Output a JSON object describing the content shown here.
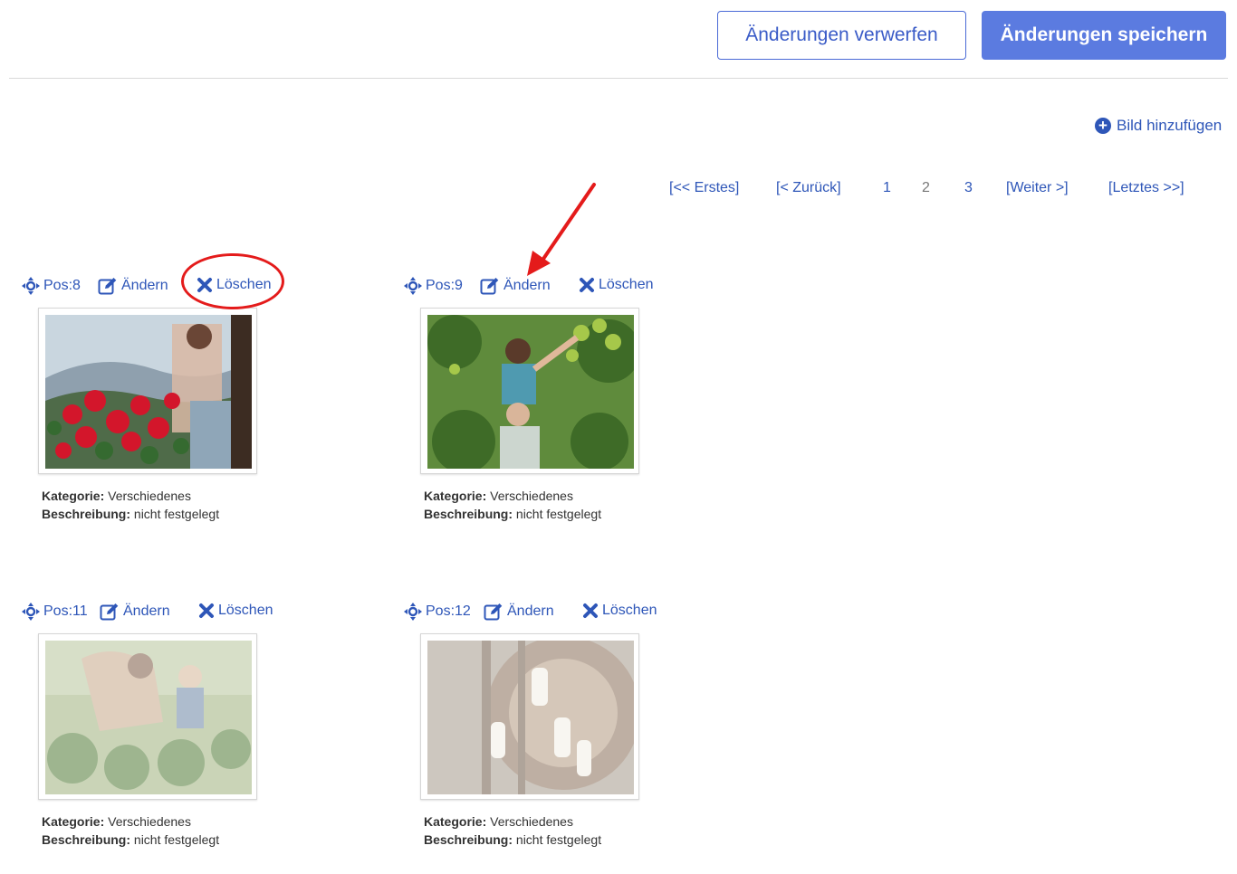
{
  "toolbar": {
    "discard_label": "Änderungen verwerfen",
    "save_label": "Änderungen speichern"
  },
  "add_image_label": "Bild hinzufügen",
  "pagination": {
    "first": "[<< Erstes]",
    "prev": "[< Zurück]",
    "pages": [
      "1",
      "2",
      "3"
    ],
    "current_page": "2",
    "next": "[Weiter >]",
    "last": "[Letztes >>]"
  },
  "cards": [
    {
      "pos": "Pos:8",
      "edit_label": "Ändern",
      "delete_label": "Löschen",
      "category_label": "Kategorie:",
      "category_value": "Verschiedenes",
      "description_label": "Beschreibung:",
      "description_value": "nicht festgelegt"
    },
    {
      "pos": "Pos:9",
      "edit_label": "Ändern",
      "delete_label": "Löschen",
      "category_label": "Kategorie:",
      "category_value": "Verschiedenes",
      "description_label": "Beschreibung:",
      "description_value": "nicht festgelegt"
    },
    {
      "pos": "Pos:11",
      "edit_label": "Ändern",
      "delete_label": "Löschen",
      "category_label": "Kategorie:",
      "category_value": "Verschiedenes",
      "description_label": "Beschreibung:",
      "description_value": "nicht festgelegt"
    },
    {
      "pos": "Pos:12",
      "edit_label": "Ändern",
      "delete_label": "Löschen",
      "category_label": "Kategorie:",
      "category_value": "Verschiedenes",
      "description_label": "Beschreibung:",
      "description_value": "nicht festgelegt"
    }
  ],
  "colors": {
    "link": "#2e56b8",
    "primary_button": "#5b7be0",
    "annotation_red": "#e41b1b"
  },
  "icons": [
    "move-icon",
    "edit-icon",
    "delete-icon",
    "plus-circle-icon"
  ]
}
